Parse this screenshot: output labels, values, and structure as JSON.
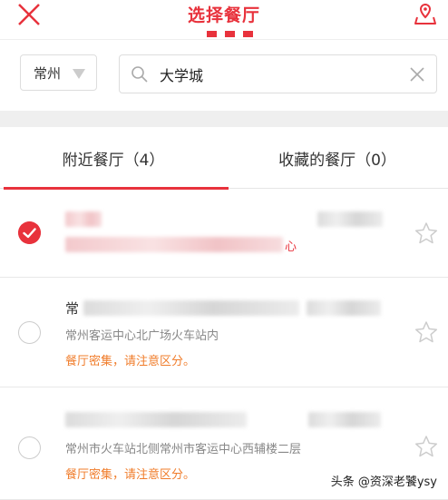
{
  "header": {
    "title": "选择餐厅",
    "accent": "#e8323c",
    "close_icon": "close-icon",
    "map_icon": "map-location-icon"
  },
  "search": {
    "city": "常州",
    "query": "大学城",
    "placeholder": ""
  },
  "tabs": [
    {
      "label": "附近餐厅（4）",
      "active": true
    },
    {
      "label": "收藏的餐厅（0）",
      "active": false
    }
  ],
  "items": [
    {
      "name": "",
      "address_tail": "心",
      "note": "",
      "selected": true
    },
    {
      "name": "常",
      "address": "常州客运中心北广场火车站内",
      "note": "餐厅密集，请注意区分。",
      "selected": false
    },
    {
      "name": "",
      "address": "常州市火车站北侧常州市客运中心西辅楼二层",
      "note": "餐厅密集，请注意区分。",
      "selected": false
    }
  ],
  "watermark": "头条 @资深老饕ysy"
}
